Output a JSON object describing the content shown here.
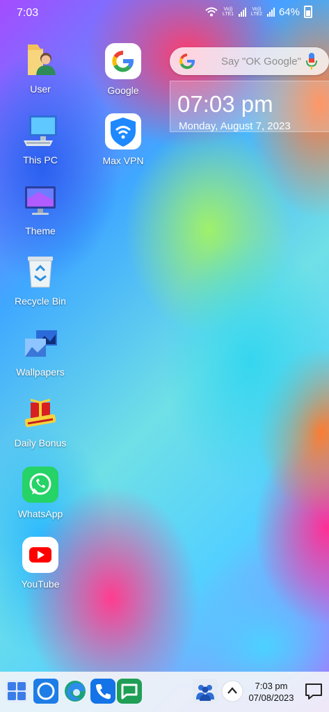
{
  "status_bar": {
    "time": "7:03",
    "battery": "64%",
    "sim1": "Vo)) LTE1",
    "sim2": "Vo)) LTE2",
    "icons": [
      "wifi-icon",
      "signal-icon",
      "battery-icon"
    ]
  },
  "desktop_icons": [
    {
      "label": "User",
      "icon": "user-folder-icon"
    },
    {
      "label": "This PC",
      "icon": "computer-icon"
    },
    {
      "label": "Theme",
      "icon": "theme-icon"
    },
    {
      "label": "Recycle Bin",
      "icon": "recycle-bin-icon"
    },
    {
      "label": "Wallpapers",
      "icon": "wallpapers-icon"
    },
    {
      "label": "Daily Bonus",
      "icon": "daily-bonus-icon"
    },
    {
      "label": "WhatsApp",
      "icon": "whatsapp-icon"
    },
    {
      "label": "YouTube",
      "icon": "youtube-icon"
    },
    {
      "label": "Google",
      "icon": "google-icon"
    },
    {
      "label": "Max VPN",
      "icon": "max-vpn-icon"
    }
  ],
  "search_widget": {
    "placeholder": "Say \"OK Google\"",
    "icons": [
      "google-icon",
      "mic-icon"
    ]
  },
  "clock_widget": {
    "time": "07:03 pm",
    "date": "Monday, August 7, 2023"
  },
  "taskbar": {
    "time": "7:03 pm",
    "date": "07/08/2023",
    "icons": [
      "start-icon",
      "cortana-icon",
      "edge-icon",
      "phone-icon",
      "messages-icon",
      "people-icon",
      "chevron-up-icon",
      "notification-icon"
    ]
  },
  "colors": {
    "whatsapp": "#25d366",
    "youtube": "#ff0000",
    "vpn": "#1e88ff",
    "taskbar": "#f2f4f8"
  }
}
